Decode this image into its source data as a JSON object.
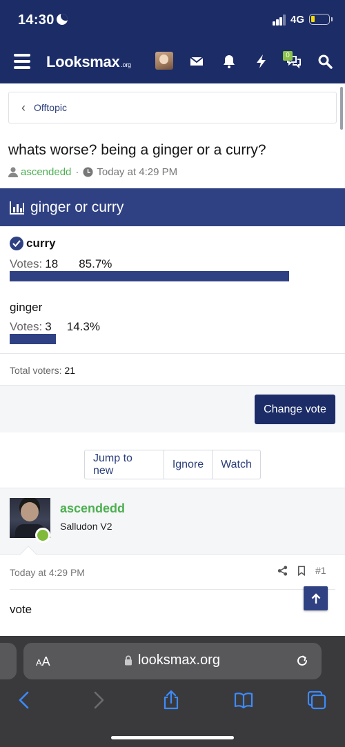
{
  "status_bar": {
    "time": "14:30",
    "network": "4G"
  },
  "nav": {
    "logo": "Looksmax",
    "logo_tld": ".org",
    "notification_badge": "0"
  },
  "breadcrumb": {
    "label": "Offtopic"
  },
  "thread": {
    "title": "whats worse? being a ginger or a curry?",
    "author": "ascendedd",
    "separator": "·",
    "time": "Today at 4:29 PM"
  },
  "poll": {
    "title": "ginger or curry",
    "votes_label": "Votes:",
    "options": [
      {
        "name": "curry",
        "votes": "18",
        "percent": "85.7%",
        "fraction": 0.857,
        "voted": true
      },
      {
        "name": "ginger",
        "votes": "3",
        "percent": "14.3%",
        "fraction": 0.143,
        "voted": false
      }
    ],
    "total_label": "Total voters:",
    "total_count": "21",
    "change_vote_label": "Change vote"
  },
  "thread_actions": {
    "jump": "Jump to new",
    "ignore": "Ignore",
    "watch": "Watch"
  },
  "post": {
    "author": "ascendedd",
    "author_title": "Salludon V2",
    "date": "Today at 4:29 PM",
    "number": "#1",
    "body": "vote"
  },
  "browser": {
    "aa_small": "A",
    "aa_big": "A",
    "url": "looksmax.org"
  },
  "colors": {
    "brand_navy": "#1b2c67",
    "poll_blue": "#2f4183",
    "author_green": "#4caf50",
    "online_green": "#7fba3a",
    "browser_chrome": "#3a3a3c",
    "ios_blue": "#3d8bfd"
  },
  "icons": {
    "nav": [
      "hamburger-icon",
      "envelope-icon",
      "bell-icon",
      "bolt-icon",
      "chat-bubbles-icon",
      "search-icon"
    ],
    "poll": "bar-chart-icon",
    "post": [
      "share-icon",
      "bookmark-icon"
    ],
    "browser": [
      "back-arrow-icon",
      "forward-arrow-icon",
      "share-upload-icon",
      "book-icon",
      "tabs-icon"
    ]
  }
}
